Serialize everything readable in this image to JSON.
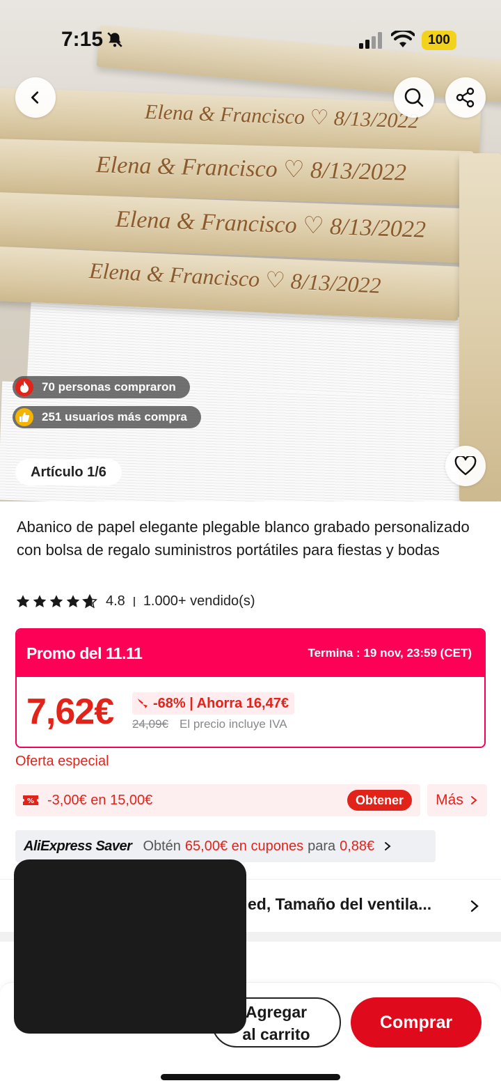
{
  "status_bar": {
    "time": "7:15",
    "battery": "100"
  },
  "gallery": {
    "engravings": [
      "Elena & Francisco ♡ 8/13/2022",
      "Elena & Francisco ♡ 8/13/2022",
      "Elena & Francisco ♡ 8/13/2022",
      "Elena & Francisco ♡ 8/13/2022"
    ],
    "social_proof": [
      {
        "text": "70 personas compraron",
        "icon": "fire-icon",
        "color": "#e2231a"
      },
      {
        "text": "251 usuarios más compra",
        "icon": "thumbs-up-icon",
        "color": "#f4b400"
      }
    ],
    "article_counter": "Artículo 1/6"
  },
  "product": {
    "title": "Abanico de papel elegante plegable blanco grabado personalizado con bolsa de regalo suministros portátiles para fiestas y bodas",
    "rating": "4.8",
    "sold": "1.000+ vendido(s)"
  },
  "promo": {
    "name": "Promo del 11.11",
    "ends": "Termina : 19 nov, 23:59 (CET)",
    "price": "7,62€",
    "discount": "-68% | Ahorra 16,47€",
    "old_price": "24,09€",
    "tax_note": "El precio incluye IVA",
    "accent": "#fc0155"
  },
  "offer": {
    "special_label": "Oferta especial",
    "coupon_text": "-3,00€ en 15,00€",
    "obtain_label": "Obtener",
    "more_label": "Más"
  },
  "saver": {
    "brand": "AliExpress Saver",
    "text_before": "Obtén ",
    "amount": "65,00€ en cupones",
    "text_mid": " para ",
    "price": "0,88€"
  },
  "variant": {
    "text": "ed, Tamaño del ventila..."
  },
  "actions": {
    "cart_label_1": "Agregar",
    "cart_label_2": "al carrito",
    "buy_label": "Comprar"
  }
}
